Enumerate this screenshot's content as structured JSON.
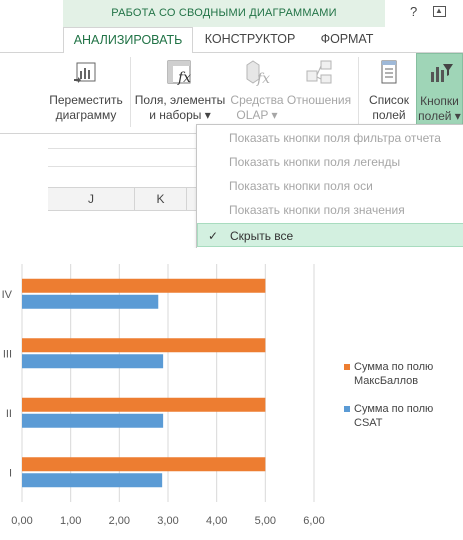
{
  "ribbon": {
    "context_title": "РАБОТА СО СВОДНЫМИ ДИАГРАММАМИ",
    "help": "?",
    "tabs": [
      {
        "label": "АНАЛИЗИРОВАТЬ",
        "active": true
      },
      {
        "label": "КОНСТРУКТОР",
        "active": false
      },
      {
        "label": "ФОРМАТ",
        "active": false
      }
    ],
    "buttons": {
      "move_chart": {
        "line1": "Переместить",
        "line2": "диаграмму"
      },
      "fields_items": {
        "line1": "Поля, элементы",
        "line2": "и наборы ▾"
      },
      "olap": {
        "line1": "Средства",
        "line2": "OLAP ▾"
      },
      "relations": {
        "line1": "Отношения"
      },
      "field_list": {
        "line1": "Список",
        "line2": "полей"
      },
      "field_buttons": {
        "line1": "Кнопки",
        "line2": "полей ▾"
      }
    }
  },
  "sheet": {
    "columns": [
      "J",
      "K"
    ]
  },
  "menu": {
    "items": [
      {
        "label": "Показать кнопки поля фильтра отчета",
        "enabled": false
      },
      {
        "label": "Показать кнопки поля легенды",
        "enabled": false
      },
      {
        "label": "Показать кнопки поля оси",
        "enabled": false
      },
      {
        "label": "Показать кнопки поля значения",
        "enabled": false
      },
      {
        "label": "Скрыть все",
        "enabled": true,
        "checked": true
      }
    ],
    "check_mark": "✓"
  },
  "chart_data": {
    "type": "bar",
    "orientation": "horizontal",
    "categories": [
      "I",
      "II",
      "III",
      "IV"
    ],
    "series": [
      {
        "name": "Сумма по полю МаксБаллов",
        "color": "#ED7D31",
        "values": [
          5.0,
          5.0,
          5.0,
          5.0
        ]
      },
      {
        "name": "Сумма по полю CSAT",
        "color": "#5B9BD5",
        "values": [
          2.88,
          2.9,
          2.9,
          2.8
        ]
      }
    ],
    "xlim": [
      0,
      6
    ],
    "xticks": [
      "0,00",
      "1,00",
      "2,00",
      "3,00",
      "4,00",
      "5,00",
      "6,00"
    ],
    "grid": true,
    "legend_position": "right"
  }
}
